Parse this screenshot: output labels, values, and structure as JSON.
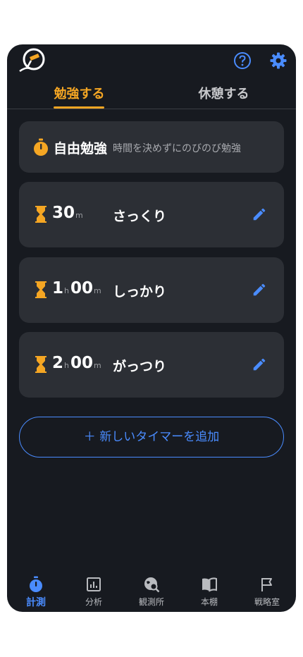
{
  "header": {
    "logo_icon": "telescope-logo-icon",
    "help_icon": "help-circle-icon",
    "settings_icon": "gear-icon"
  },
  "tabs": [
    {
      "label": "勉強する",
      "active": true
    },
    {
      "label": "休憩する",
      "active": false
    }
  ],
  "free_study": {
    "title": "自由勉強",
    "description": "時間を決めずにのびのび勉強",
    "icon": "stopwatch-icon"
  },
  "timers": [
    {
      "hours": "",
      "minutes": "30",
      "hour_unit": "",
      "minute_unit": "m",
      "name": "さっくり"
    },
    {
      "hours": "1",
      "minutes": "00",
      "hour_unit": "h",
      "minute_unit": "m",
      "name": "しっかり"
    },
    {
      "hours": "2",
      "minutes": "00",
      "hour_unit": "h",
      "minute_unit": "m",
      "name": "がっつり"
    }
  ],
  "add_timer": {
    "label": "＋  新しいタイマーを追加"
  },
  "bottom_nav": [
    {
      "label": "計測",
      "icon": "stopwatch-icon",
      "active": true
    },
    {
      "label": "分析",
      "icon": "chart-icon",
      "active": false
    },
    {
      "label": "観測所",
      "icon": "globe-search-icon",
      "active": false
    },
    {
      "label": "本棚",
      "icon": "book-icon",
      "active": false
    },
    {
      "label": "戦略室",
      "icon": "flag-icon",
      "active": false
    }
  ],
  "colors": {
    "accent": "#f5a623",
    "link": "#4a8cff",
    "background": "#171a20",
    "card": "#2c2f35"
  }
}
